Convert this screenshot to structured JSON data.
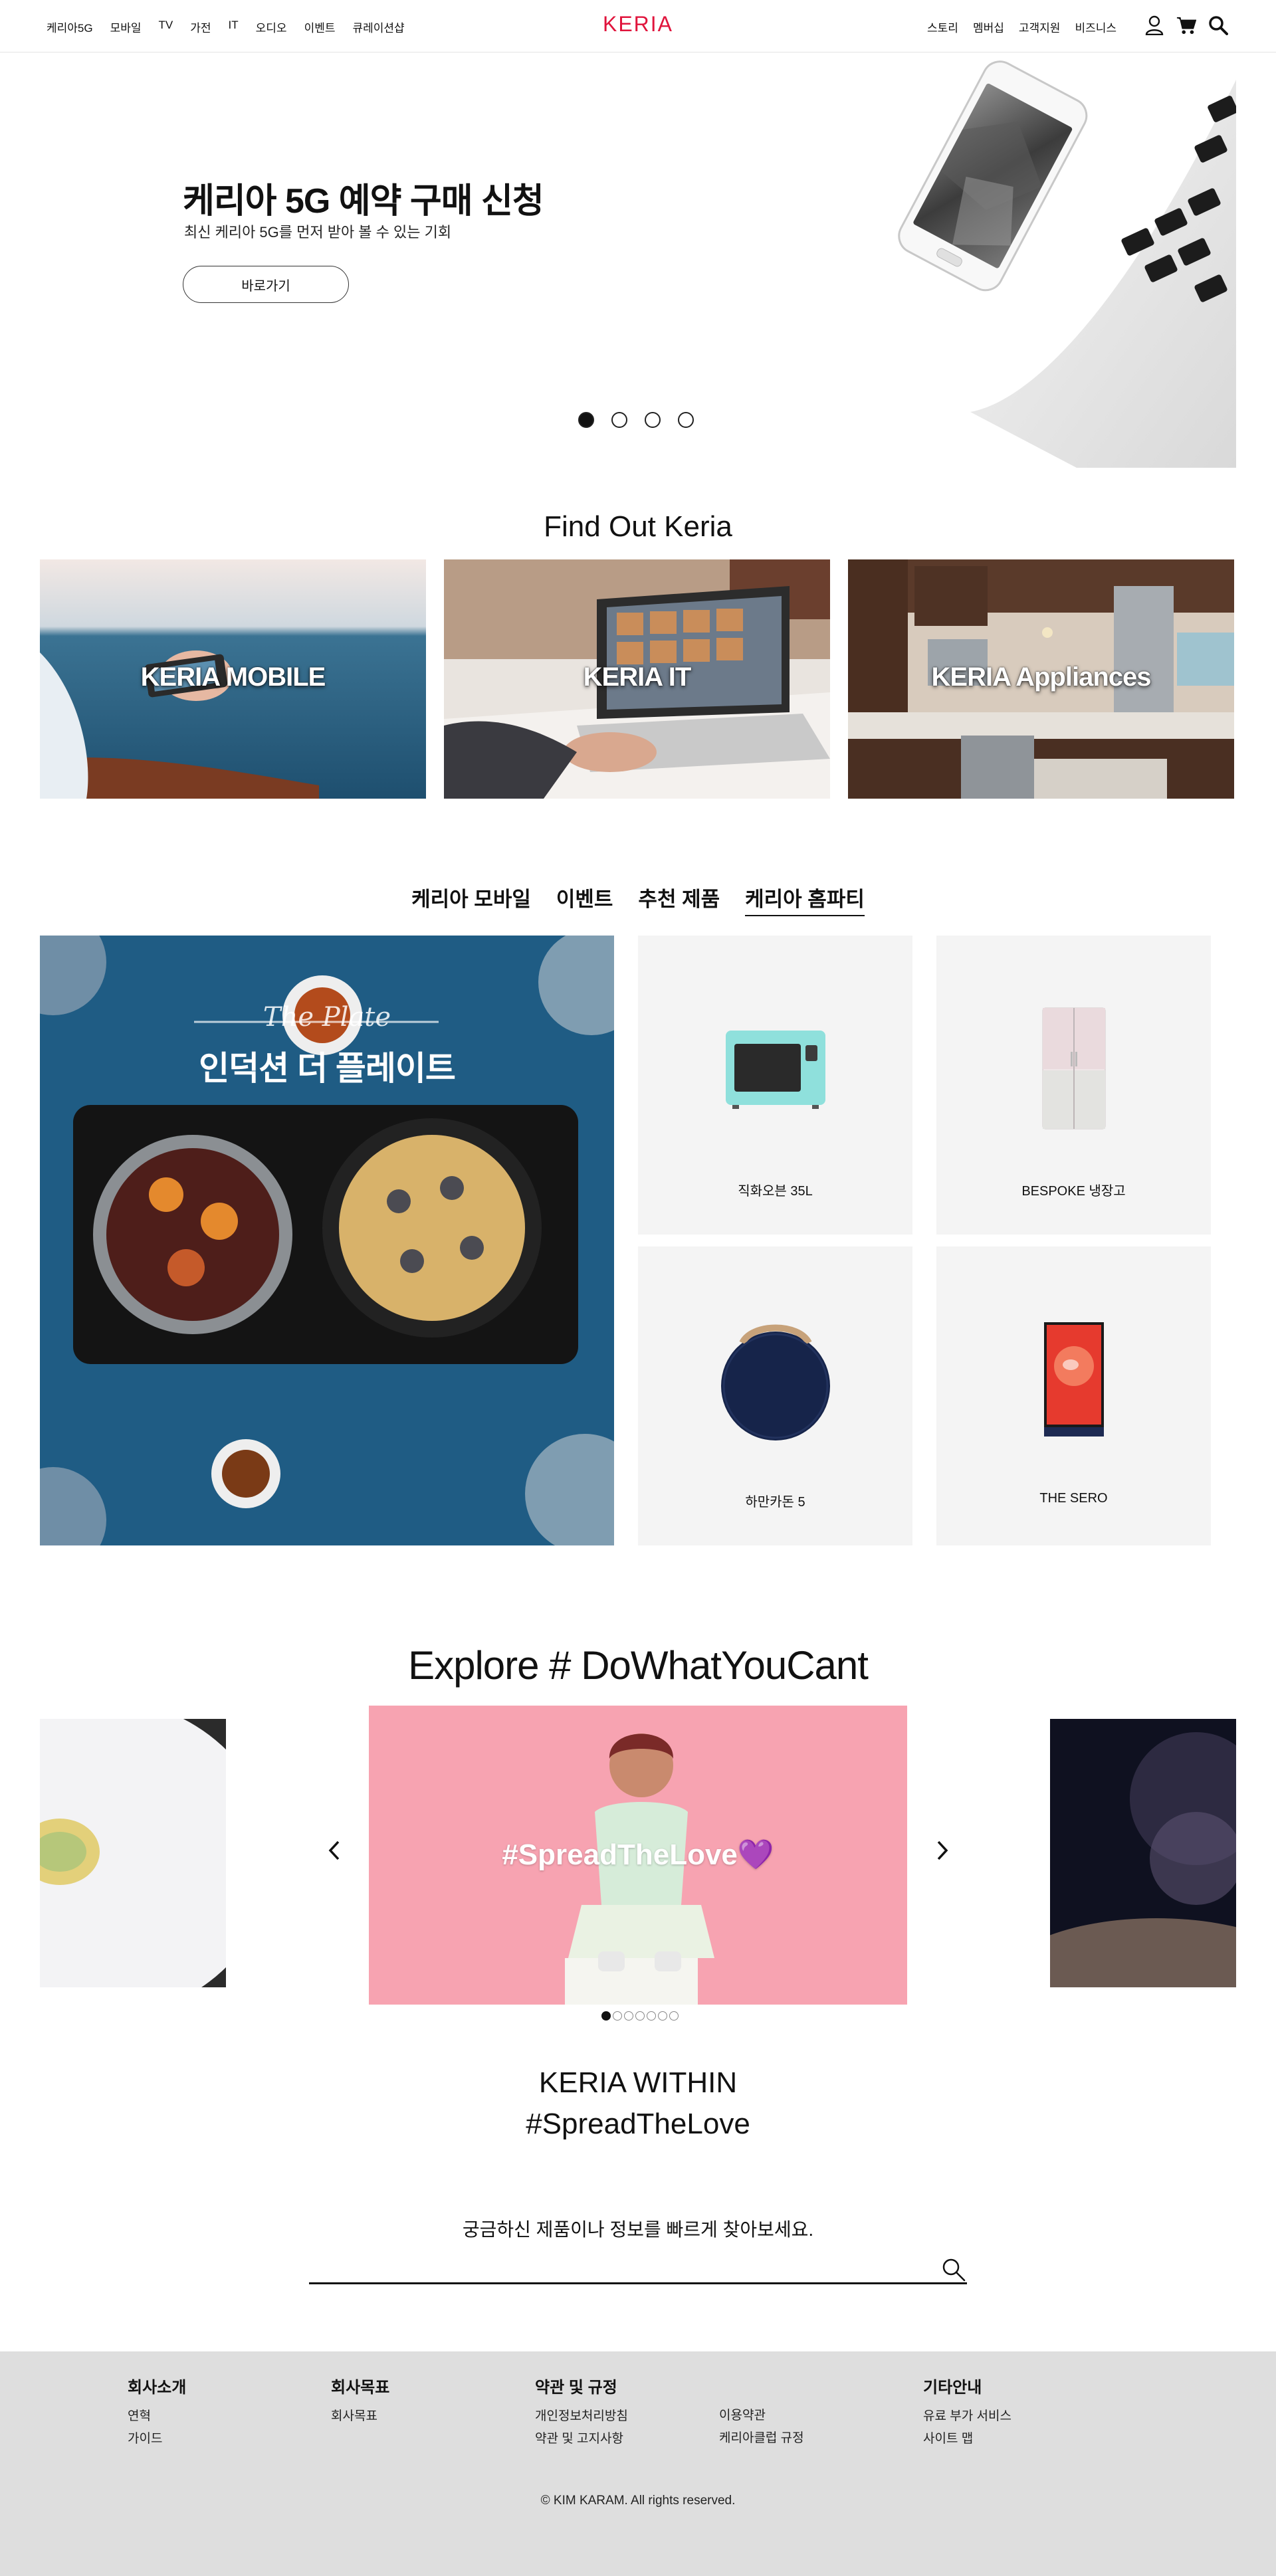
{
  "header": {
    "logo": "KERIA",
    "nav_left": [
      "케리아5G",
      "모바일",
      "TV",
      "가전",
      "IT",
      "오디오",
      "이벤트",
      "큐레이션샵"
    ],
    "nav_right": [
      "스토리",
      "멤버십",
      "고객지원",
      "비즈니스"
    ],
    "icons": [
      "user-icon",
      "cart-icon",
      "search-icon"
    ]
  },
  "hero": {
    "title": "케리아 5G 예약 구매 신청",
    "subtitle": "최신 케리아 5G를 먼저 받아 볼 수 있는 기회",
    "button": "바로가기",
    "slide_count": 4,
    "active_slide": 1
  },
  "find_out": {
    "title": "Find Out Keria",
    "cards": [
      {
        "label": "KERIA MOBILE"
      },
      {
        "label": "KERIA IT"
      },
      {
        "label": "KERIA Appliances"
      }
    ]
  },
  "tabs": {
    "items": [
      "케리아 모바일",
      "이벤트",
      "추천 제품",
      "케리아 홈파티"
    ],
    "active": "케리아 홈파티"
  },
  "promo": {
    "script": "The Plate",
    "title": "인덕션 더 플레이트"
  },
  "products": [
    {
      "name": "직화오븐 35L",
      "icon": "oven-icon"
    },
    {
      "name": "BESPOKE 냉장고",
      "icon": "fridge-icon"
    },
    {
      "name": "하만카돈 5",
      "icon": "speaker-icon"
    },
    {
      "name": "THE SERO",
      "icon": "tv-icon"
    }
  ],
  "explore": {
    "title": "Explore # DoWhatYouCant",
    "slide_text": "#SpreadTheLove💜",
    "dot_count": 7,
    "active_dot": 1,
    "within_line1": "KERIA WITHIN",
    "within_line2": "#SpreadTheLove"
  },
  "search": {
    "prompt": "궁금하신 제품이나 정보를 빠르게 찾아보세요.",
    "placeholder": "",
    "value": ""
  },
  "footer": {
    "columns": [
      {
        "title": "회사소개",
        "links": [
          "연혁",
          "가이드"
        ]
      },
      {
        "title": "회사목표",
        "links": [
          "회사목표"
        ]
      },
      {
        "title": "약관 및 규정",
        "links": [
          "개인정보처리방침",
          "약관 및 고지사항"
        ]
      },
      {
        "title": "",
        "links": [
          "이용약관",
          "케리아클럽 규정"
        ]
      },
      {
        "title": "기타안내",
        "links": [
          "유료 부가 서비스",
          "사이트 맵"
        ]
      }
    ],
    "copyright": "© KIM KARAM. All rights reserved."
  },
  "colors": {
    "brand": "#e0143c",
    "footer_bg": "#dedede",
    "card_bg": "#f4f4f4",
    "promo_bg": "#1f5c84",
    "explore_bg": "#f7a3b1"
  }
}
